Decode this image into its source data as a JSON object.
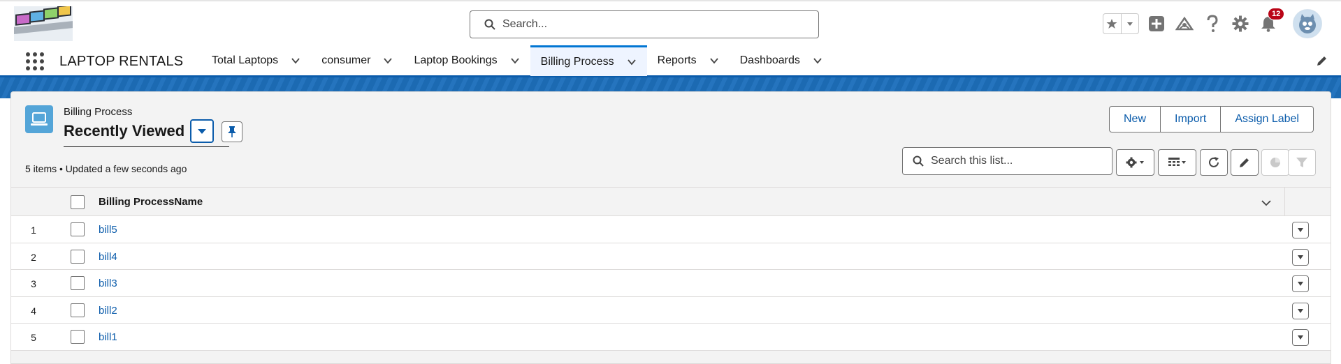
{
  "header": {
    "search_placeholder": "Search...",
    "notification_count": "12",
    "icons": [
      "favorites-star-icon",
      "favorites-list-chevron-icon",
      "global-add-icon",
      "trailhead-icon",
      "help-icon",
      "setup-gear-icon",
      "notifications-bell-icon",
      "user-avatar"
    ]
  },
  "nav": {
    "app_name": "LAPTOP RENTALS",
    "tabs": [
      {
        "label": "Total Laptops",
        "active": false
      },
      {
        "label": "consumer",
        "active": false
      },
      {
        "label": "Laptop Bookings",
        "active": false
      },
      {
        "label": "Billing Process",
        "active": true
      },
      {
        "label": "Reports",
        "active": false
      },
      {
        "label": "Dashboards",
        "active": false
      }
    ]
  },
  "list_view": {
    "object_label": "Billing Process",
    "title": "Recently Viewed",
    "meta": "5 items • Updated a few seconds ago",
    "actions": {
      "new": "New",
      "import": "Import",
      "assign_label": "Assign Label"
    },
    "search_placeholder": "Search this list...",
    "column": "Billing ProcessName",
    "rows": [
      {
        "num": "1",
        "name": "bill5"
      },
      {
        "num": "2",
        "name": "bill4"
      },
      {
        "num": "3",
        "name": "bill3"
      },
      {
        "num": "4",
        "name": "bill2"
      },
      {
        "num": "5",
        "name": "bill1"
      }
    ]
  },
  "colors": {
    "brand_blue": "#0176d3",
    "link_blue": "#0b5cab",
    "object_icon": "#54a5d8",
    "badge_red": "#ba0517"
  }
}
